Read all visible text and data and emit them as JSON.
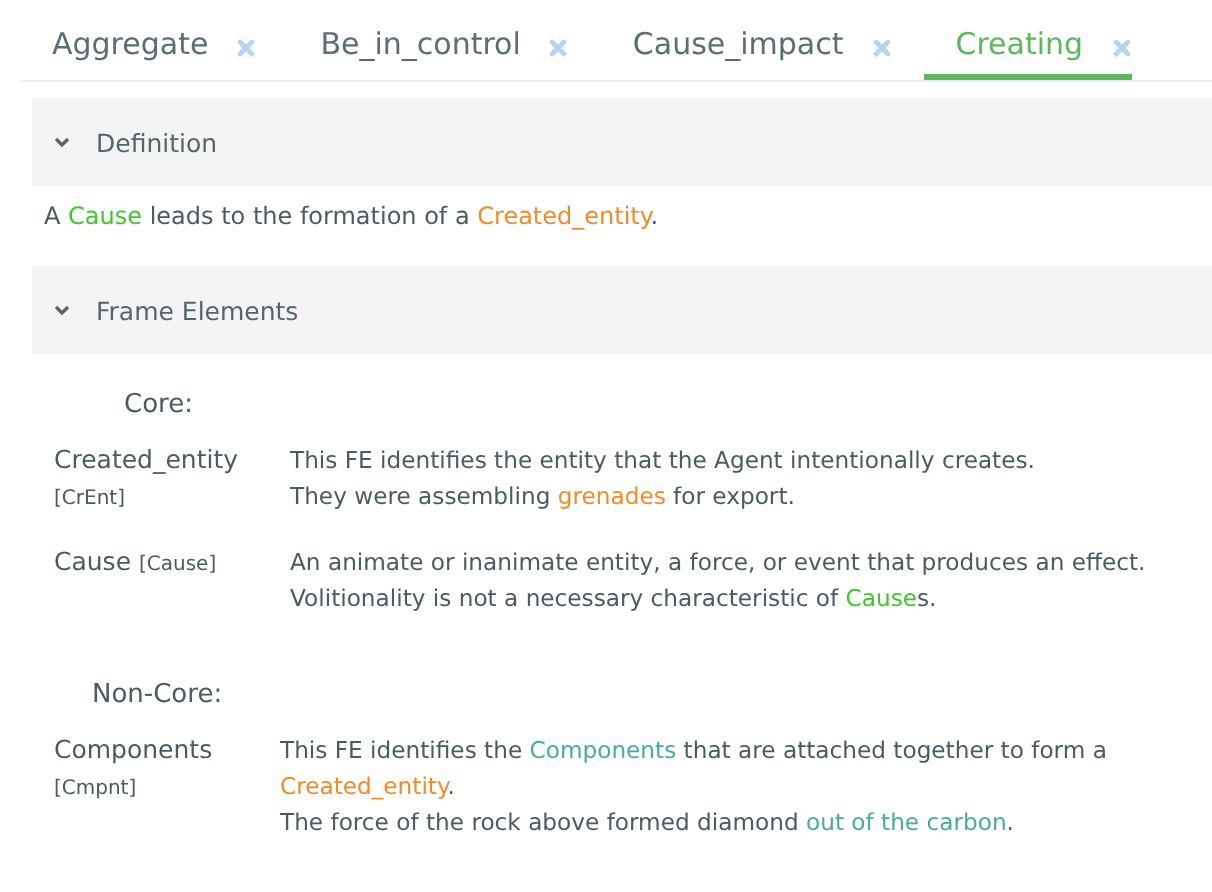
{
  "tabs": [
    {
      "label": "Aggregate",
      "selected": false
    },
    {
      "label": "Be_in_control",
      "selected": false
    },
    {
      "label": "Cause_impact",
      "selected": false
    },
    {
      "label": "Creating",
      "selected": true
    }
  ],
  "sections": [
    {
      "title": "Definition",
      "expanded": true
    },
    {
      "title": "Frame Elements",
      "expanded": true
    }
  ],
  "definition": [
    {
      "text": "A "
    },
    {
      "text": "Cause",
      "color": "#44c52c"
    },
    {
      "text": " leads to the formation of a "
    },
    {
      "text": "Created_entity",
      "color": "#f28a2a"
    },
    {
      "text": "."
    }
  ],
  "groups": [
    {
      "heading": "Core:",
      "elements": [
        {
          "name": "Created_entity",
          "abbr": "[CrEnt]",
          "lines": [
            [
              {
                "text": "This FE identifies the entity that the Agent intentionally creates."
              }
            ],
            [
              {
                "text": "They were assembling "
              },
              {
                "text": "grenades",
                "color": "#f28a2a"
              },
              {
                "text": " for export."
              }
            ]
          ]
        },
        {
          "name": "Cause",
          "abbr": "[Cause]",
          "lines": [
            [
              {
                "text": "An animate or inanimate entity, a force, or event that produces an effect. Volitionality is not a necessary characteristic of "
              },
              {
                "text": "Cause",
                "color": "#44c52c"
              },
              {
                "text": "s."
              }
            ]
          ]
        }
      ]
    },
    {
      "heading": "Non-Core:",
      "elements": [
        {
          "name": "Components",
          "abbr": "[Cmpnt]",
          "lines": [
            [
              {
                "text": "This FE identifies the "
              },
              {
                "text": "Components",
                "color": "#4aab9d"
              },
              {
                "text": " that are attached together to form a "
              },
              {
                "text": "Created_entity",
                "color": "#f28a2a"
              },
              {
                "text": "."
              }
            ],
            [
              {
                "text": "The force of the rock above formed diamond "
              },
              {
                "text": "out of the carbon",
                "color": "#4aab9d"
              },
              {
                "text": "."
              }
            ]
          ]
        }
      ]
    }
  ]
}
